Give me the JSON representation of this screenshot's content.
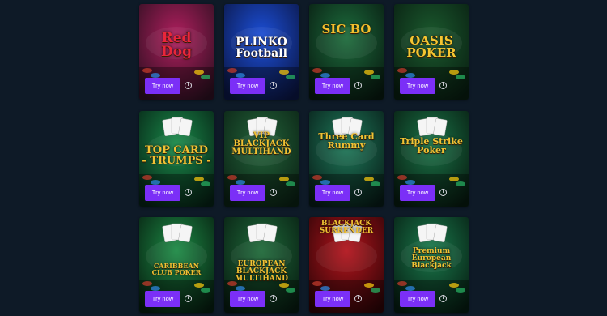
{
  "games": [
    {
      "title": "Red\nDog",
      "button": "Try now",
      "info_icon": "info-icon",
      "bg_top": "#b01f5e",
      "bg_bottom": "#2a0f1f",
      "title_color": "#e9263a"
    },
    {
      "title": "PLINKO\nFootball",
      "button": "Try now",
      "info_icon": "info-icon",
      "bg_top": "#1c4fd8",
      "bg_bottom": "#0a1440",
      "title_color": "#ffffff"
    },
    {
      "title": "SIC BO",
      "button": "Try now",
      "info_icon": "info-icon",
      "bg_top": "#1d6b3c",
      "bg_bottom": "#07180f",
      "title_color": "#f3c12e"
    },
    {
      "title": "OASIS\nPOKER",
      "button": "Try now",
      "info_icon": "info-icon",
      "bg_top": "#1b5a2e",
      "bg_bottom": "#081c10",
      "title_color": "#f4c531"
    },
    {
      "title": "TOP CARD\n- TRUMPS -",
      "button": "Try now",
      "info_icon": "info-icon",
      "bg_top": "#1a8a4a",
      "bg_bottom": "#062014",
      "title_color": "#f1c234"
    },
    {
      "title": "VIP\nBLACKJACK\nMULTIHAND",
      "button": "Try now",
      "info_icon": "info-icon",
      "bg_top": "#23643a",
      "bg_bottom": "#0a1f13",
      "title_color": "#f1c234"
    },
    {
      "title": "Three Card\nRummy",
      "button": "Try now",
      "info_icon": "info-icon",
      "bg_top": "#1f7a5a",
      "bg_bottom": "#071a16",
      "title_color": "#f1c234"
    },
    {
      "title": "Triple Strike\nPoker",
      "button": "Try now",
      "info_icon": "info-icon",
      "bg_top": "#1a7347",
      "bg_bottom": "#07190f",
      "title_color": "#f1c234"
    },
    {
      "title": "CARIBBEAN\nCLUB POKER",
      "button": "Try now",
      "info_icon": "info-icon",
      "bg_top": "#1d8a45",
      "bg_bottom": "#061c0f",
      "title_color": "#f1c234"
    },
    {
      "title": "EUROPEAN\nBLACKJACK\nMULTIHAND",
      "button": "Try now",
      "info_icon": "info-icon",
      "bg_top": "#1f6a3a",
      "bg_bottom": "#071a10",
      "title_color": "#f1c234"
    },
    {
      "title": "BLACKJACK\nSURRENDER",
      "button": "Try now",
      "info_icon": "info-icon",
      "bg_top": "#b3151d",
      "bg_bottom": "#2a0406",
      "title_color": "#f1c234"
    },
    {
      "title": "Premium European\nBlackjack",
      "button": "Try now",
      "info_icon": "info-icon",
      "bg_top": "#1a7a4c",
      "bg_bottom": "#061b11",
      "title_color": "#f1c234"
    }
  ]
}
